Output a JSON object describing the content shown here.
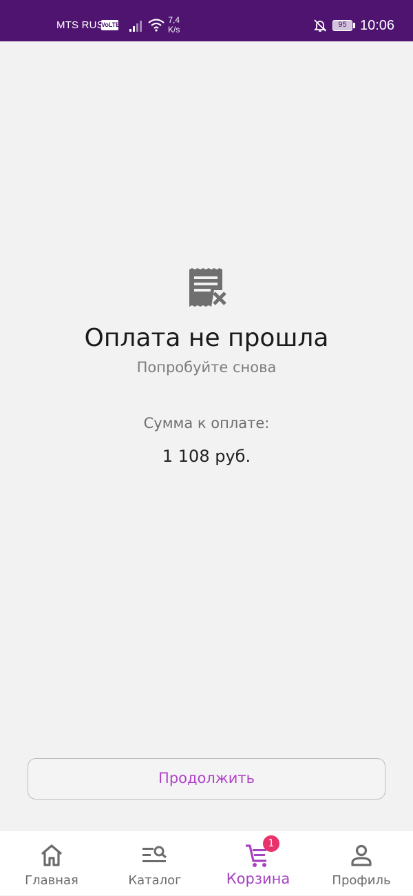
{
  "status_bar": {
    "carrier": "MTS RUS",
    "volte": "VoLTE",
    "speed_value": "7,4",
    "speed_unit": "K/s",
    "battery": "95",
    "time": "10:06"
  },
  "payment": {
    "icon": "receipt-cancel-icon",
    "title": "Оплата не прошла",
    "subtitle": "Попробуйте снова",
    "sum_label": "Сумма к оплате:",
    "sum_value": "1 108 руб."
  },
  "continue_button": {
    "label": "Продолжить"
  },
  "bottom_nav": {
    "items": [
      {
        "label": "Главная",
        "icon": "home-icon"
      },
      {
        "label": "Каталог",
        "icon": "catalog-search-icon"
      },
      {
        "label": "Корзина",
        "icon": "cart-icon",
        "badge": "1",
        "active": true
      },
      {
        "label": "Профиль",
        "icon": "profile-icon"
      }
    ]
  },
  "colors": {
    "status_bar_bg": "#4f1470",
    "accent": "#a641c2",
    "badge": "#e8336b",
    "background": "#f2f2f2"
  }
}
